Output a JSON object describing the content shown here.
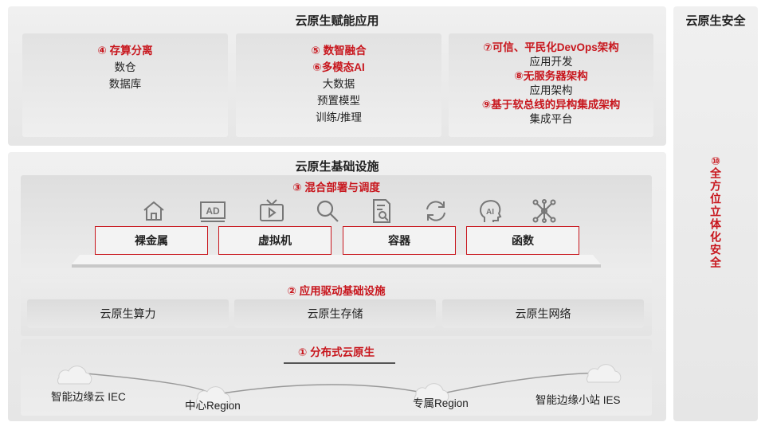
{
  "app_layer": {
    "title": "云原生赋能应用",
    "col1": {
      "red": [
        "④ 存算分离"
      ],
      "items": [
        "数仓",
        "数据库"
      ]
    },
    "col2": {
      "red": [
        "⑤ 数智融合",
        "⑥多模态AI"
      ],
      "items": [
        "大数据",
        "预置模型",
        "训练/推理"
      ]
    },
    "col3": {
      "lines": [
        {
          "text": "⑦可信、平民化DevOps架构",
          "red": true
        },
        {
          "text": "应用开发",
          "red": false
        },
        {
          "text": "⑧无服务器架构",
          "red": true
        },
        {
          "text": "应用架构",
          "red": false
        },
        {
          "text": "⑨基于软总线的异构集成架构",
          "red": true
        },
        {
          "text": "集成平台",
          "red": false
        }
      ]
    }
  },
  "infra": {
    "title": "云原生基础设施",
    "hybrid": {
      "title": "③ 混合部署与调度",
      "icons": [
        "home-icon",
        "ad-icon",
        "tv-icon",
        "search-icon",
        "document-search-icon",
        "refresh-icon",
        "ai-head-icon",
        "network-icon"
      ],
      "boxes": [
        "裸金属",
        "虚拟机",
        "容器",
        "函数"
      ]
    },
    "app_driven": {
      "title": "② 应用驱动基础设施",
      "cells": [
        "云原生算力",
        "云原生存储",
        "云原生网络"
      ]
    },
    "distributed": {
      "title": "① 分布式云原生",
      "labels": [
        "智能边缘云 IEC",
        "中心Region",
        "专属Region",
        "智能边缘小站 IES"
      ]
    }
  },
  "security": {
    "title": "云原生安全",
    "num": "⑩",
    "vertical": "全方位立体化安全"
  },
  "colors": {
    "accent": "#c8161d",
    "panel": "#eeeeee"
  }
}
